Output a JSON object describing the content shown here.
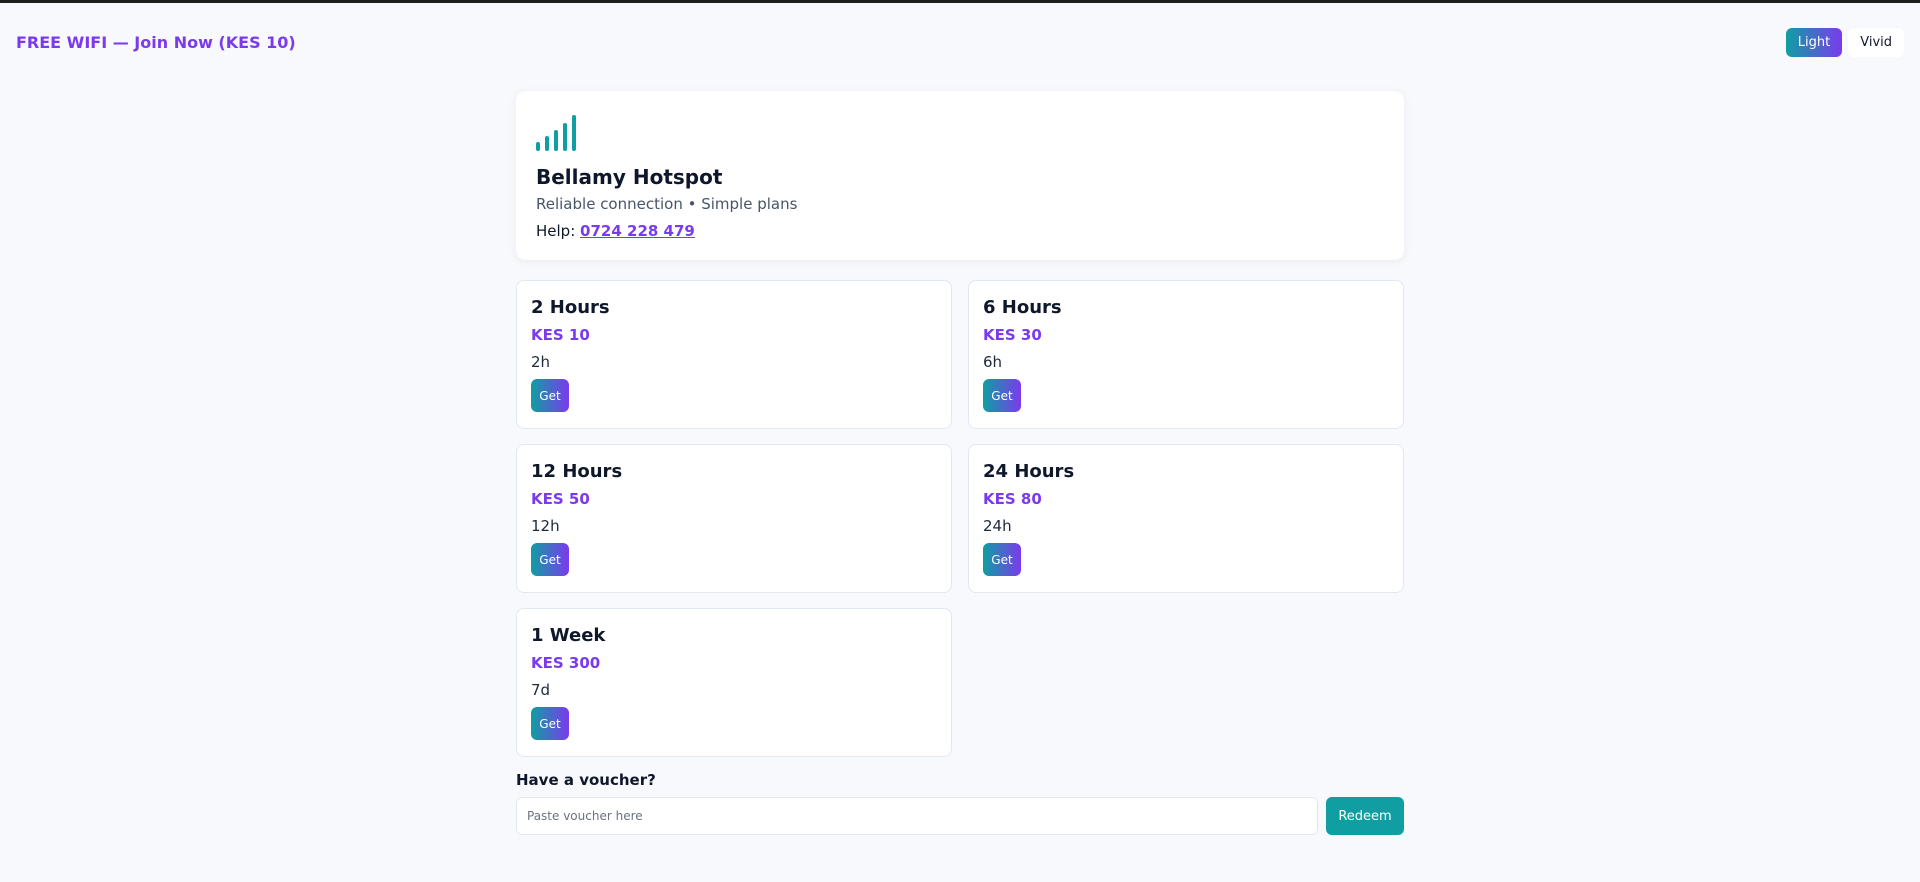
{
  "topbar": {
    "promo_label": "FREE WIFI — Join Now (KES 10)",
    "theme_light": "Light",
    "theme_vivid": "Vivid"
  },
  "hero": {
    "icon": "signal-bars-icon",
    "title": "Bellamy Hotspot",
    "tagline": "Reliable connection • Simple plans",
    "help_label": "Help:",
    "help_phone": "0724 228 479"
  },
  "plans": [
    {
      "name": "2 Hours",
      "price": "KES 10",
      "duration": "2h",
      "button": "Get"
    },
    {
      "name": "6 Hours",
      "price": "KES 30",
      "duration": "6h",
      "button": "Get"
    },
    {
      "name": "12 Hours",
      "price": "KES 50",
      "duration": "12h",
      "button": "Get"
    },
    {
      "name": "24 Hours",
      "price": "KES 80",
      "duration": "24h",
      "button": "Get"
    },
    {
      "name": "1 Week",
      "price": "KES 300",
      "duration": "7d",
      "button": "Get"
    }
  ],
  "voucher": {
    "label": "Have a voucher?",
    "placeholder": "Paste voucher here",
    "value": "",
    "button": "Redeem"
  },
  "colors": {
    "accent_teal": "#0f9ea2",
    "accent_purple": "#7c3aed",
    "background": "#f8f9fc"
  }
}
